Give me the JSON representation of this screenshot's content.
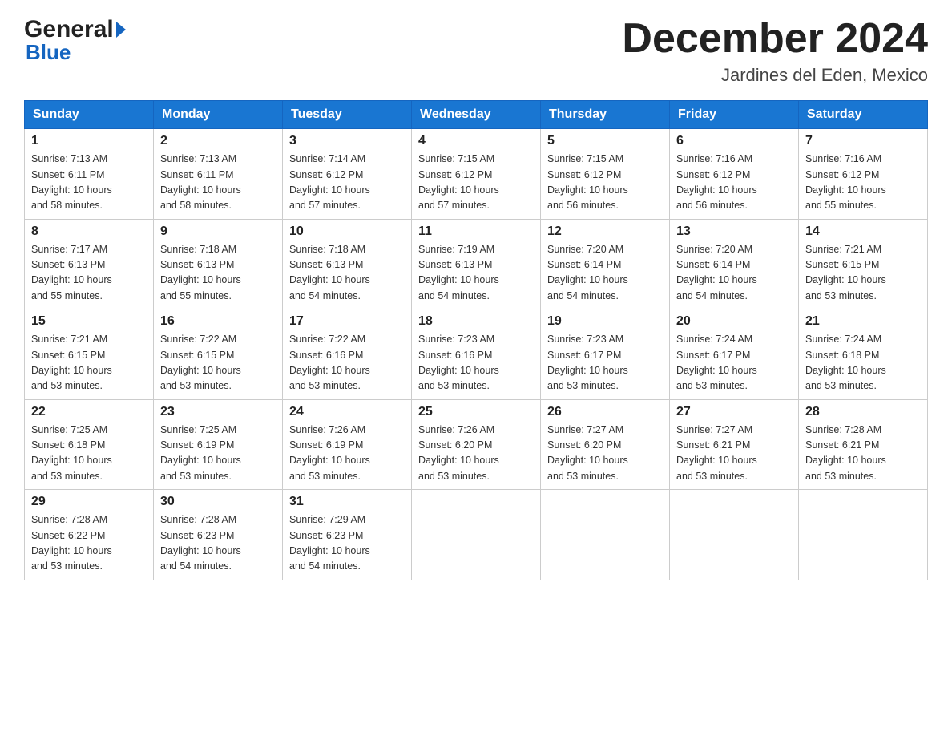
{
  "header": {
    "logo_general": "General",
    "logo_blue": "Blue",
    "month_title": "December 2024",
    "location": "Jardines del Eden, Mexico"
  },
  "weekdays": [
    "Sunday",
    "Monday",
    "Tuesday",
    "Wednesday",
    "Thursday",
    "Friday",
    "Saturday"
  ],
  "weeks": [
    [
      {
        "day": "1",
        "sunrise": "7:13 AM",
        "sunset": "6:11 PM",
        "daylight": "10 hours and 58 minutes."
      },
      {
        "day": "2",
        "sunrise": "7:13 AM",
        "sunset": "6:11 PM",
        "daylight": "10 hours and 58 minutes."
      },
      {
        "day": "3",
        "sunrise": "7:14 AM",
        "sunset": "6:12 PM",
        "daylight": "10 hours and 57 minutes."
      },
      {
        "day": "4",
        "sunrise": "7:15 AM",
        "sunset": "6:12 PM",
        "daylight": "10 hours and 57 minutes."
      },
      {
        "day": "5",
        "sunrise": "7:15 AM",
        "sunset": "6:12 PM",
        "daylight": "10 hours and 56 minutes."
      },
      {
        "day": "6",
        "sunrise": "7:16 AM",
        "sunset": "6:12 PM",
        "daylight": "10 hours and 56 minutes."
      },
      {
        "day": "7",
        "sunrise": "7:16 AM",
        "sunset": "6:12 PM",
        "daylight": "10 hours and 55 minutes."
      }
    ],
    [
      {
        "day": "8",
        "sunrise": "7:17 AM",
        "sunset": "6:13 PM",
        "daylight": "10 hours and 55 minutes."
      },
      {
        "day": "9",
        "sunrise": "7:18 AM",
        "sunset": "6:13 PM",
        "daylight": "10 hours and 55 minutes."
      },
      {
        "day": "10",
        "sunrise": "7:18 AM",
        "sunset": "6:13 PM",
        "daylight": "10 hours and 54 minutes."
      },
      {
        "day": "11",
        "sunrise": "7:19 AM",
        "sunset": "6:13 PM",
        "daylight": "10 hours and 54 minutes."
      },
      {
        "day": "12",
        "sunrise": "7:20 AM",
        "sunset": "6:14 PM",
        "daylight": "10 hours and 54 minutes."
      },
      {
        "day": "13",
        "sunrise": "7:20 AM",
        "sunset": "6:14 PM",
        "daylight": "10 hours and 54 minutes."
      },
      {
        "day": "14",
        "sunrise": "7:21 AM",
        "sunset": "6:15 PM",
        "daylight": "10 hours and 53 minutes."
      }
    ],
    [
      {
        "day": "15",
        "sunrise": "7:21 AM",
        "sunset": "6:15 PM",
        "daylight": "10 hours and 53 minutes."
      },
      {
        "day": "16",
        "sunrise": "7:22 AM",
        "sunset": "6:15 PM",
        "daylight": "10 hours and 53 minutes."
      },
      {
        "day": "17",
        "sunrise": "7:22 AM",
        "sunset": "6:16 PM",
        "daylight": "10 hours and 53 minutes."
      },
      {
        "day": "18",
        "sunrise": "7:23 AM",
        "sunset": "6:16 PM",
        "daylight": "10 hours and 53 minutes."
      },
      {
        "day": "19",
        "sunrise": "7:23 AM",
        "sunset": "6:17 PM",
        "daylight": "10 hours and 53 minutes."
      },
      {
        "day": "20",
        "sunrise": "7:24 AM",
        "sunset": "6:17 PM",
        "daylight": "10 hours and 53 minutes."
      },
      {
        "day": "21",
        "sunrise": "7:24 AM",
        "sunset": "6:18 PM",
        "daylight": "10 hours and 53 minutes."
      }
    ],
    [
      {
        "day": "22",
        "sunrise": "7:25 AM",
        "sunset": "6:18 PM",
        "daylight": "10 hours and 53 minutes."
      },
      {
        "day": "23",
        "sunrise": "7:25 AM",
        "sunset": "6:19 PM",
        "daylight": "10 hours and 53 minutes."
      },
      {
        "day": "24",
        "sunrise": "7:26 AM",
        "sunset": "6:19 PM",
        "daylight": "10 hours and 53 minutes."
      },
      {
        "day": "25",
        "sunrise": "7:26 AM",
        "sunset": "6:20 PM",
        "daylight": "10 hours and 53 minutes."
      },
      {
        "day": "26",
        "sunrise": "7:27 AM",
        "sunset": "6:20 PM",
        "daylight": "10 hours and 53 minutes."
      },
      {
        "day": "27",
        "sunrise": "7:27 AM",
        "sunset": "6:21 PM",
        "daylight": "10 hours and 53 minutes."
      },
      {
        "day": "28",
        "sunrise": "7:28 AM",
        "sunset": "6:21 PM",
        "daylight": "10 hours and 53 minutes."
      }
    ],
    [
      {
        "day": "29",
        "sunrise": "7:28 AM",
        "sunset": "6:22 PM",
        "daylight": "10 hours and 53 minutes."
      },
      {
        "day": "30",
        "sunrise": "7:28 AM",
        "sunset": "6:23 PM",
        "daylight": "10 hours and 54 minutes."
      },
      {
        "day": "31",
        "sunrise": "7:29 AM",
        "sunset": "6:23 PM",
        "daylight": "10 hours and 54 minutes."
      },
      null,
      null,
      null,
      null
    ]
  ],
  "labels": {
    "sunrise": "Sunrise:",
    "sunset": "Sunset:",
    "daylight": "Daylight:"
  }
}
